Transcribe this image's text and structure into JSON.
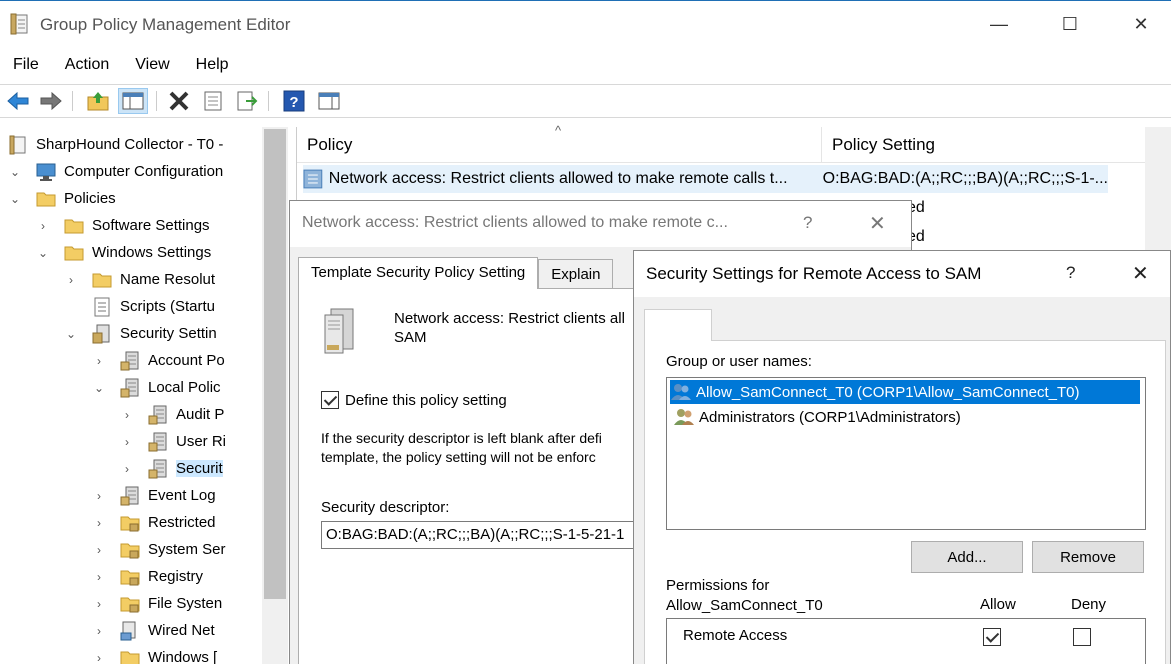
{
  "window": {
    "title": "Group Policy Management Editor",
    "minimize": "—",
    "maximize": "☐",
    "close": "✕"
  },
  "menu": [
    "File",
    "Action",
    "View",
    "Help"
  ],
  "tree": [
    {
      "label": "SharpHound Collector - T0 -",
      "icon": "policy-doc-icon",
      "level": 0,
      "expander": ""
    },
    {
      "label": "Computer Configuration",
      "icon": "computer-icon",
      "level": 0,
      "expander": "⌄"
    },
    {
      "label": "Policies",
      "icon": "folder-icon",
      "level": 1,
      "expander": "⌄"
    },
    {
      "label": "Software Settings",
      "icon": "folder-icon",
      "level": 2,
      "expander": "›"
    },
    {
      "label": "Windows Settings",
      "icon": "folder-icon",
      "level": 2,
      "expander": "⌄"
    },
    {
      "label": "Name Resolut",
      "icon": "folder-icon",
      "level": 3,
      "expander": "›"
    },
    {
      "label": "Scripts (Startu",
      "icon": "scripts-icon",
      "level": 3,
      "expander": ""
    },
    {
      "label": "Security Settin",
      "icon": "security-settings-icon",
      "level": 3,
      "expander": "⌄"
    },
    {
      "label": "Account Po",
      "icon": "policy-icon",
      "level": 4,
      "expander": "›"
    },
    {
      "label": "Local Polic",
      "icon": "policy-icon",
      "level": 4,
      "expander": "⌄"
    },
    {
      "label": "Audit P",
      "icon": "policy-icon",
      "level": 5,
      "expander": "›"
    },
    {
      "label": "User Ri",
      "icon": "policy-icon",
      "level": 5,
      "expander": "›"
    },
    {
      "label": "Securit",
      "icon": "policy-icon",
      "level": 5,
      "expander": "›",
      "selected": true
    },
    {
      "label": "Event Log",
      "icon": "policy-icon",
      "level": 4,
      "expander": "›"
    },
    {
      "label": "Restricted",
      "icon": "folder-lock-icon",
      "level": 4,
      "expander": "›"
    },
    {
      "label": "System Ser",
      "icon": "folder-lock-icon",
      "level": 4,
      "expander": "›"
    },
    {
      "label": "Registry",
      "icon": "folder-lock-icon",
      "level": 4,
      "expander": "›"
    },
    {
      "label": "File Systen",
      "icon": "folder-lock-icon",
      "level": 4,
      "expander": "›"
    },
    {
      "label": "Wired Net",
      "icon": "network-icon",
      "level": 4,
      "expander": "›"
    },
    {
      "label": "Windows [",
      "icon": "folder-icon",
      "level": 4,
      "expander": "›"
    }
  ],
  "list": {
    "columns": [
      "Policy",
      "Policy Setting"
    ],
    "rows": [
      {
        "policy": "Network access: Restrict clients allowed to make remote calls t...",
        "setting": "O:BAG:BAD:(A;;RC;;;BA)(A;;RC;;;S-1-..."
      },
      {
        "policy": "",
        "setting": "ed"
      },
      {
        "policy": "",
        "setting": "ed"
      }
    ]
  },
  "properties_dialog": {
    "title": "Network access: Restrict clients allowed to make remote c...",
    "help": "?",
    "close": "✕",
    "tabs": [
      "Template Security Policy Setting",
      "Explain"
    ],
    "policy_name_line1": "Network access: Restrict clients all",
    "policy_name_line2": "SAM",
    "define_label": "Define this policy setting",
    "define_checked": true,
    "info_line1": "If the security descriptor is left blank after defi",
    "info_line2": "template, the policy setting will not be enforc",
    "descriptor_label": "Security descriptor:",
    "descriptor_value": "O:BAG:BAD:(A;;RC;;;BA)(A;;RC;;;S-1-5-21-1"
  },
  "security_dialog": {
    "title": "Security Settings for Remote Access to SAM",
    "help": "?",
    "close": "✕",
    "group_label": "Group or user names:",
    "users": [
      {
        "name": "Allow_SamConnect_T0 (CORP1\\Allow_SamConnect_T0)",
        "selected": true
      },
      {
        "name": "Administrators (CORP1\\Administrators)",
        "selected": false
      }
    ],
    "add_button": "Add...",
    "remove_button": "Remove",
    "permissions_label_line1": "Permissions for",
    "permissions_label_line2": "Allow_SamConnect_T0",
    "allow_header": "Allow",
    "deny_header": "Deny",
    "permissions": [
      {
        "name": "Remote Access",
        "allow": true,
        "deny": false
      }
    ]
  }
}
